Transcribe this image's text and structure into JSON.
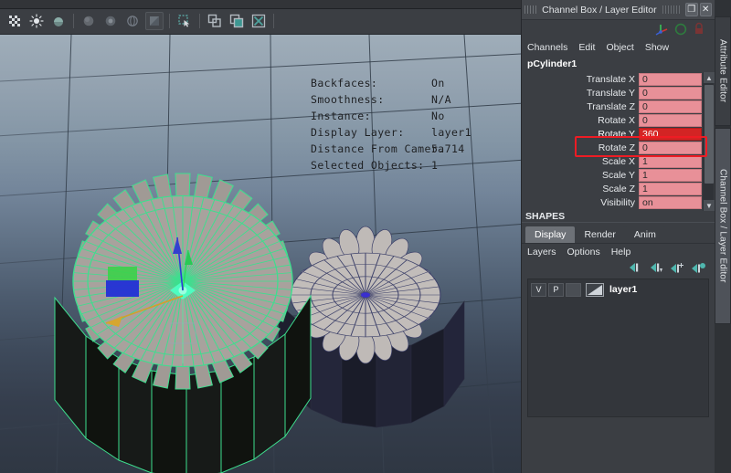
{
  "app": {
    "viewport_hud": {
      "rows": [
        {
          "label": "Backfaces:",
          "value": "On"
        },
        {
          "label": "Smoothness:",
          "value": "N/A"
        },
        {
          "label": "Instance:",
          "value": "No"
        },
        {
          "label": "Display Layer:",
          "value": "layer1"
        },
        {
          "label": "Distance From Camera",
          "value": "5.714"
        },
        {
          "label": "Selected Objects:",
          "value": "1"
        }
      ]
    },
    "toolbar": {
      "icons": [
        "texture-grid-icon",
        "light-bulb-icon",
        "shaded-flat-icon",
        "separator",
        "smooth-shade-icon",
        "hardware-texture-icon",
        "wireframe-sphere-icon",
        "xray-shaded-icon",
        "separator",
        "select-marquee-icon",
        "separator",
        "isolate-select-icon",
        "panel-copy-icon",
        "snapshot-icon",
        "separator"
      ]
    }
  },
  "channel_box": {
    "title": "Channel Box / Layer Editor",
    "title_buttons": {
      "restore": "❐",
      "close": "✕"
    },
    "menus": [
      "Channels",
      "Edit",
      "Object",
      "Show"
    ],
    "node_name": "pCylinder1",
    "axis_icons": [
      "axis-tripod-icon",
      "refresh-circle-icon",
      "lock-icon"
    ],
    "channels": [
      {
        "name": "Translate X",
        "value": "0",
        "selected": false
      },
      {
        "name": "Translate Y",
        "value": "0",
        "selected": false
      },
      {
        "name": "Translate Z",
        "value": "0",
        "selected": false
      },
      {
        "name": "Rotate X",
        "value": "0",
        "selected": false
      },
      {
        "name": "Rotate Y",
        "value": "360",
        "selected": true
      },
      {
        "name": "Rotate Z",
        "value": "0",
        "selected": false
      },
      {
        "name": "Scale X",
        "value": "1",
        "selected": false
      },
      {
        "name": "Scale Y",
        "value": "1",
        "selected": false
      },
      {
        "name": "Scale Z",
        "value": "1",
        "selected": false
      },
      {
        "name": "Visibility",
        "value": "on",
        "selected": false
      }
    ],
    "shapes_label": "SHAPES",
    "scroll_up": "▲",
    "scroll_down": "▼",
    "highlight_color": "#ee1c24",
    "field_color": "#e89098",
    "selected_field_color": "#d32424"
  },
  "layer_editor": {
    "tabs": [
      {
        "label": "Display",
        "active": true
      },
      {
        "label": "Render",
        "active": false
      },
      {
        "label": "Anim",
        "active": false
      }
    ],
    "menus": [
      "Layers",
      "Options",
      "Help"
    ],
    "tool_icons": [
      "layer-move-up-icon",
      "layer-move-down-icon",
      "layer-new-icon",
      "layer-new-from-selected-icon"
    ],
    "layers": [
      {
        "visibility": "V",
        "playback": "P",
        "template": "",
        "name": "layer1"
      }
    ]
  },
  "side_tabs": [
    {
      "label": "Attribute Editor",
      "active": false
    },
    {
      "label": "Channel Box / Layer Editor",
      "active": true
    }
  ]
}
